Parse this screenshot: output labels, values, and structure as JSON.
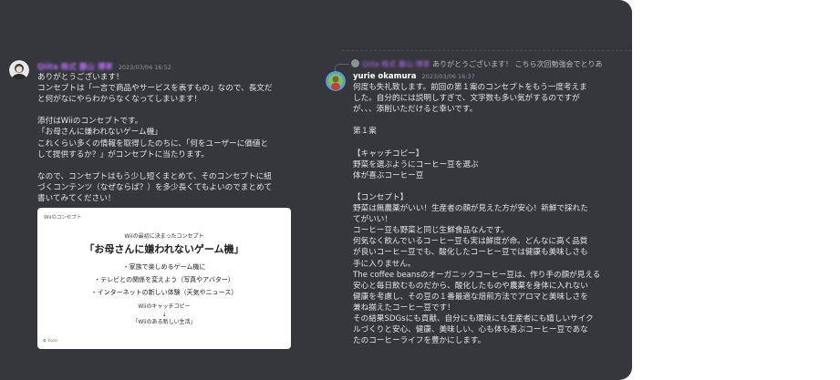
{
  "colors": {
    "background": "#36373d",
    "name_blurred": "#b16ef0",
    "timestamp": "#8e9297",
    "text": "#e3e5e8"
  },
  "left_message": {
    "author": "Qiita 株式 藤山 博孝",
    "timestamp": "2023/03/06 16:52",
    "lines": [
      "ありがとうございます！",
      "コンセプトは「一言で商品やサービスを表すもの」なので、長文だ",
      "と何がなにやらわからなくなってしまいます！",
      "",
      "添付はWiiのコンセプトです。",
      "「お母さんに嫌われないゲーム機」",
      "これくらい多くの情報を取得したのちに、「何をユーザーに価値と",
      "して提供するか？」がコンセプトに当たります。",
      "",
      "なので、コンセプトはもう少し短くまとめて、そのコンセプトに紐",
      "づくコンテンツ（なぜならば？）を多少長くてもよいのでまとめて",
      "書いてみてください！"
    ],
    "attachment": {
      "corner_label": "Wiiのコンセプト",
      "subtitle": "Wiiの最初に決まったコンセプト",
      "title": "「お母さんに嫌われないゲーム機」",
      "bullets": [
        "・家族で楽しめるゲーム機に",
        "・テレビとの関係を変えよう（写真やアバター）",
        "・インターネットの新しい体験（天気やニュース）"
      ],
      "copy_heading": "Wiiのキャッチコピー",
      "arrow": "↓",
      "copy": "「Wiiのある新しい生活」",
      "logo": "✿ Yuoo"
    }
  },
  "right_message": {
    "reply_author": "Qiita 株式 藤山 博孝",
    "reply_text": "ありがとうございます！ こちら次回勉強会でとりあ",
    "author": "yurie okamura",
    "timestamp": "2023/03/06 16:37",
    "lines": [
      "何度も失礼致します。前回の第１案のコンセプトをもう一度考えま",
      "した。自分的には説明しすぎで、文字数も多い気がするのですが",
      "が、、、添削いただけると幸いです。",
      "",
      "第１案",
      "",
      "【キャッチコピー】",
      "野菜を選ぶようにコーヒー豆を選ぶ",
      "体が喜ぶコーヒー豆",
      "",
      "【コンセプト】",
      "野菜は無農薬がいい！生産者の顔が見えた方が安心！新鮮で採れた",
      "てがいい！",
      "コーヒー豆も野菜と同じ生鮮食品なんです。",
      "何気なく飲んでいるコーヒー豆も実は鮮度が命。どんなに高く品質",
      "が良いコーヒー豆でも、酸化したコーヒー豆では健康も美味しさも",
      "手に入りません。",
      "The coffee beansのオーガニックコーヒー豆は、作り手の顔が見える",
      "安心と毎日飲むものだから、酸化したものや農薬を身体に入れない",
      "健康を考慮し、その豆の１番最適な焙煎方法でアロマと美味しさを",
      "兼ね揃えたコーヒー豆です！",
      "その結果SDGsにも貢献、自分にも環境にも生産者にも嬉しいサイク",
      "ルづくりと安心、健康、美味しい、心も体も喜ぶコーヒー豆であな",
      "たのコーヒーライフを豊かにします。"
    ]
  }
}
